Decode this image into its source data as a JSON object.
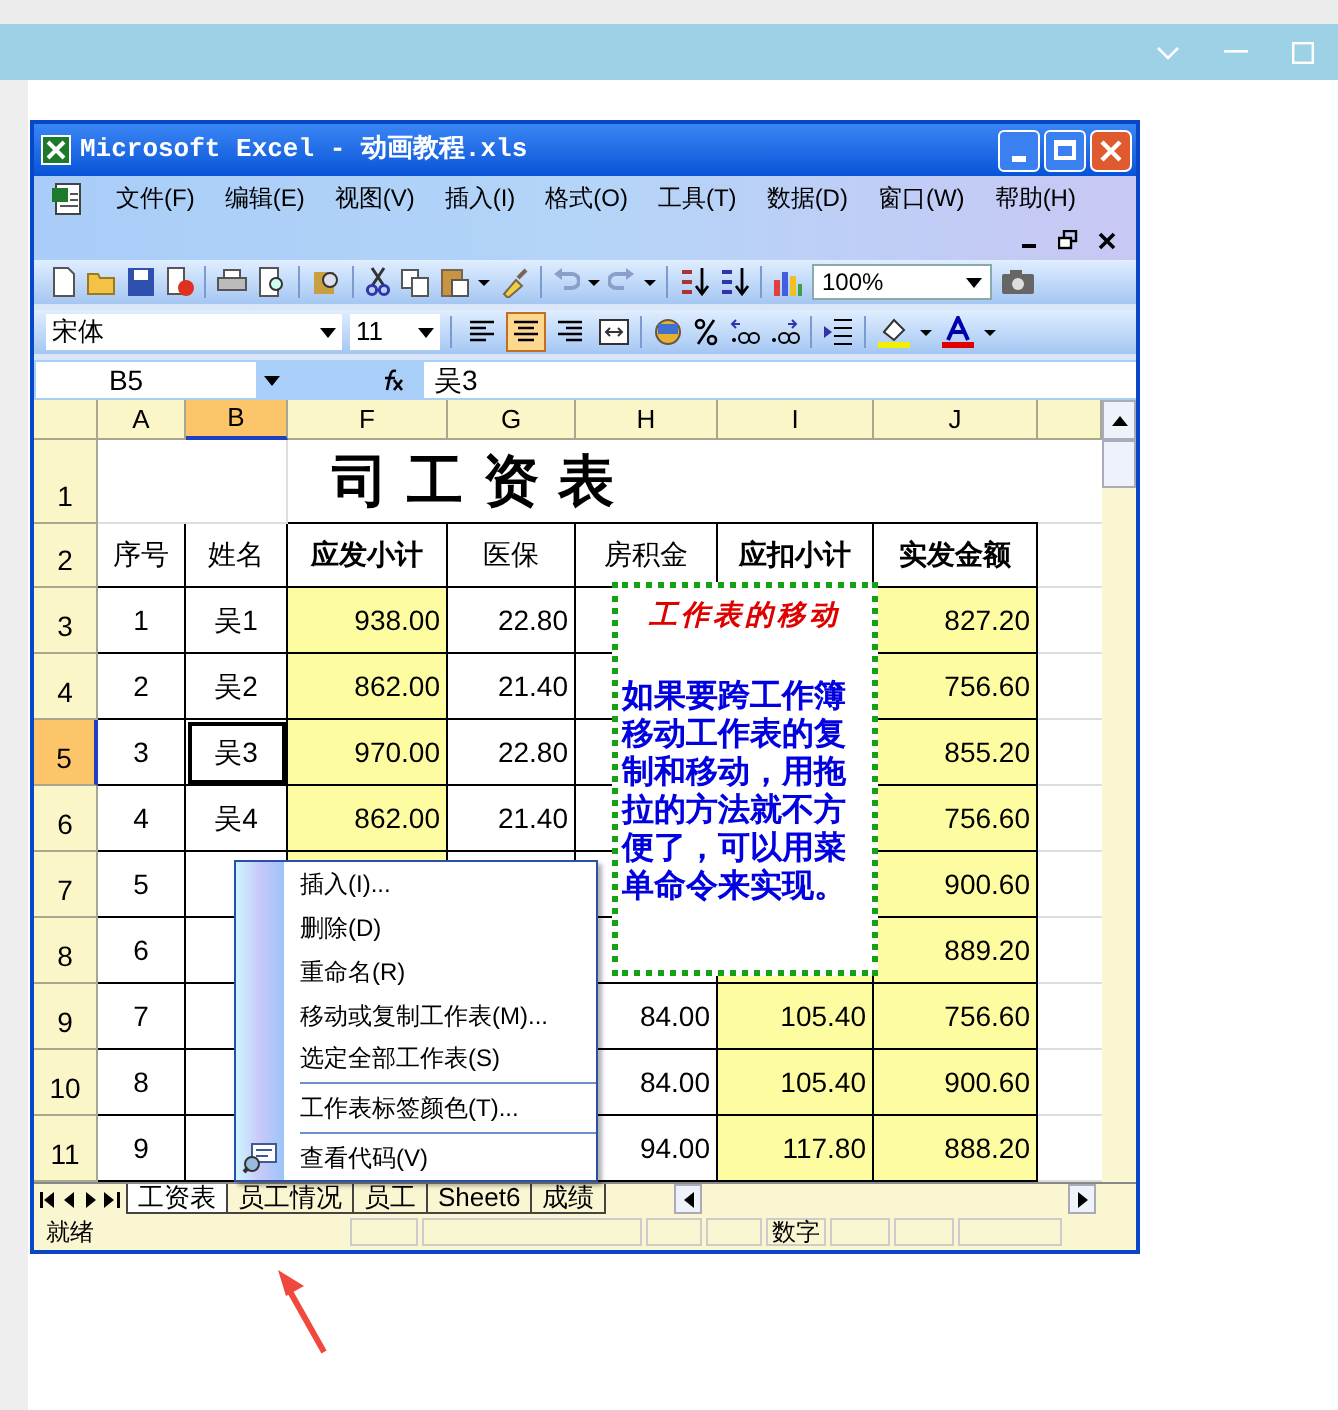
{
  "window": {
    "title": "Microsoft Excel - 动画教程.xls"
  },
  "menu_bar": [
    "文件(F)",
    "编辑(E)",
    "视图(V)",
    "插入(I)",
    "格式(O)",
    "工具(T)",
    "数据(D)",
    "窗口(W)",
    "帮助(H)"
  ],
  "toolbar": {
    "zoom": "100%",
    "font": "宋体",
    "font_size": "11",
    "alignment": [
      {
        "kind": "left",
        "selected": false
      },
      {
        "kind": "center",
        "selected": true
      },
      {
        "kind": "right",
        "selected": false
      }
    ]
  },
  "formula_bar": {
    "name_box": "B5",
    "formula": "吴3"
  },
  "sheet": {
    "columns": [
      {
        "label": "A",
        "selected": false,
        "highlight": false
      },
      {
        "label": "B",
        "selected": true,
        "highlight": false
      },
      {
        "label": "F",
        "selected": false,
        "highlight": true
      },
      {
        "label": "G",
        "selected": false,
        "highlight": false
      },
      {
        "label": "H",
        "selected": false,
        "highlight": false
      },
      {
        "label": "I",
        "selected": false,
        "highlight": true
      },
      {
        "label": "J",
        "selected": false,
        "highlight": true
      }
    ],
    "rows": [
      {
        "header": "1",
        "selected": false,
        "kind": "title",
        "title": "司 工 资 表"
      },
      {
        "header": "2",
        "selected": false,
        "kind": "header",
        "cells": [
          "序号",
          "姓名",
          "应发小计",
          "医保",
          "房积金",
          "应扣小计",
          "实发金额"
        ]
      },
      {
        "header": "3",
        "selected": false,
        "kind": "data",
        "cells": [
          "1",
          "吴1",
          "938.00",
          "22.80",
          null,
          null,
          "827.20"
        ]
      },
      {
        "header": "4",
        "selected": false,
        "kind": "data",
        "cells": [
          "2",
          "吴2",
          "862.00",
          "21.40",
          null,
          null,
          "756.60"
        ]
      },
      {
        "header": "5",
        "selected": true,
        "kind": "data",
        "cells": [
          "3",
          "吴3",
          "970.00",
          "22.80",
          null,
          null,
          "855.20"
        ]
      },
      {
        "header": "6",
        "selected": false,
        "kind": "data",
        "cells": [
          "4",
          "吴4",
          "862.00",
          "21.40",
          null,
          null,
          "756.60"
        ]
      },
      {
        "header": "7",
        "selected": false,
        "kind": "data",
        "cells": [
          "5",
          null,
          null,
          null,
          null,
          null,
          "900.60"
        ]
      },
      {
        "header": "8",
        "selected": false,
        "kind": "data",
        "cells": [
          "6",
          null,
          null,
          null,
          null,
          null,
          "889.20"
        ]
      },
      {
        "header": "9",
        "selected": false,
        "kind": "data",
        "cells": [
          "7",
          null,
          null,
          null,
          "84.00",
          "105.40",
          "756.60"
        ]
      },
      {
        "header": "10",
        "selected": false,
        "kind": "data",
        "cells": [
          "8",
          null,
          null,
          null,
          "84.00",
          "105.40",
          "900.60"
        ]
      },
      {
        "header": "11",
        "selected": false,
        "kind": "data",
        "cells": [
          "9",
          null,
          null,
          null,
          "94.00",
          "117.80",
          "888.20"
        ]
      }
    ]
  },
  "note": {
    "title": "工作表的移动",
    "text": "如果要跨工作簿移动工作表的复制和移动，用拖拉的方法就不方便了，可以用菜单命令来实现。"
  },
  "context_menu": [
    {
      "label": "插入(I)...",
      "separator_before": false,
      "kind": "plain"
    },
    {
      "label": "删除(D)",
      "separator_before": false,
      "kind": "plain"
    },
    {
      "label": "重命名(R)",
      "separator_before": false,
      "kind": "plain"
    },
    {
      "label": "移动或复制工作表(M)...",
      "separator_before": false,
      "kind": "plain"
    },
    {
      "label": "选定全部工作表(S)",
      "separator_before": false,
      "kind": "plain"
    },
    {
      "label": "工作表标签颜色(T)...",
      "separator_before": true,
      "kind": "plain"
    },
    {
      "label": "查看代码(V)",
      "separator_before": true,
      "kind": "code"
    }
  ],
  "sheet_tabs": [
    {
      "label": "工资表",
      "selected": true
    },
    {
      "label": "员工情况",
      "selected": false
    },
    {
      "label": "员工",
      "selected": false
    },
    {
      "label": "Sheet6",
      "selected": false
    },
    {
      "label": "成绩",
      "selected": false
    }
  ],
  "status_bar": {
    "state": "就绪",
    "num_lock": "数字"
  }
}
